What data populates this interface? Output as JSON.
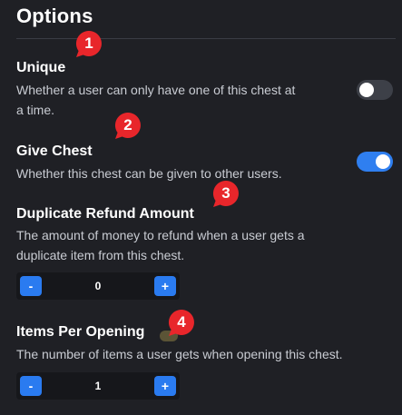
{
  "page": {
    "title": "Options"
  },
  "options": {
    "unique": {
      "label": "Unique",
      "description_line1": "Whether a user can only have one of this chest at",
      "description_line2": "a time.",
      "enabled": false
    },
    "give_chest": {
      "label": "Give Chest",
      "description": "Whether this chest can be given to other users.",
      "enabled": true
    },
    "duplicate_refund": {
      "label": "Duplicate Refund Amount",
      "description_line1": "The amount of money to refund when a user gets a",
      "description_line2": "duplicate item from this chest.",
      "value": "0",
      "minus_label": "-",
      "plus_label": "+"
    },
    "items_per_opening": {
      "label": "Items Per Opening",
      "description": "The number of items a user gets when opening this chest.",
      "value": "1",
      "minus_label": "-",
      "plus_label": "+"
    }
  },
  "markers": [
    "1",
    "2",
    "3",
    "4"
  ],
  "colors": {
    "background": "#1f2025",
    "accent": "#2f7ff0",
    "marker": "#e8262b",
    "toggle_off": "#3d4048"
  }
}
